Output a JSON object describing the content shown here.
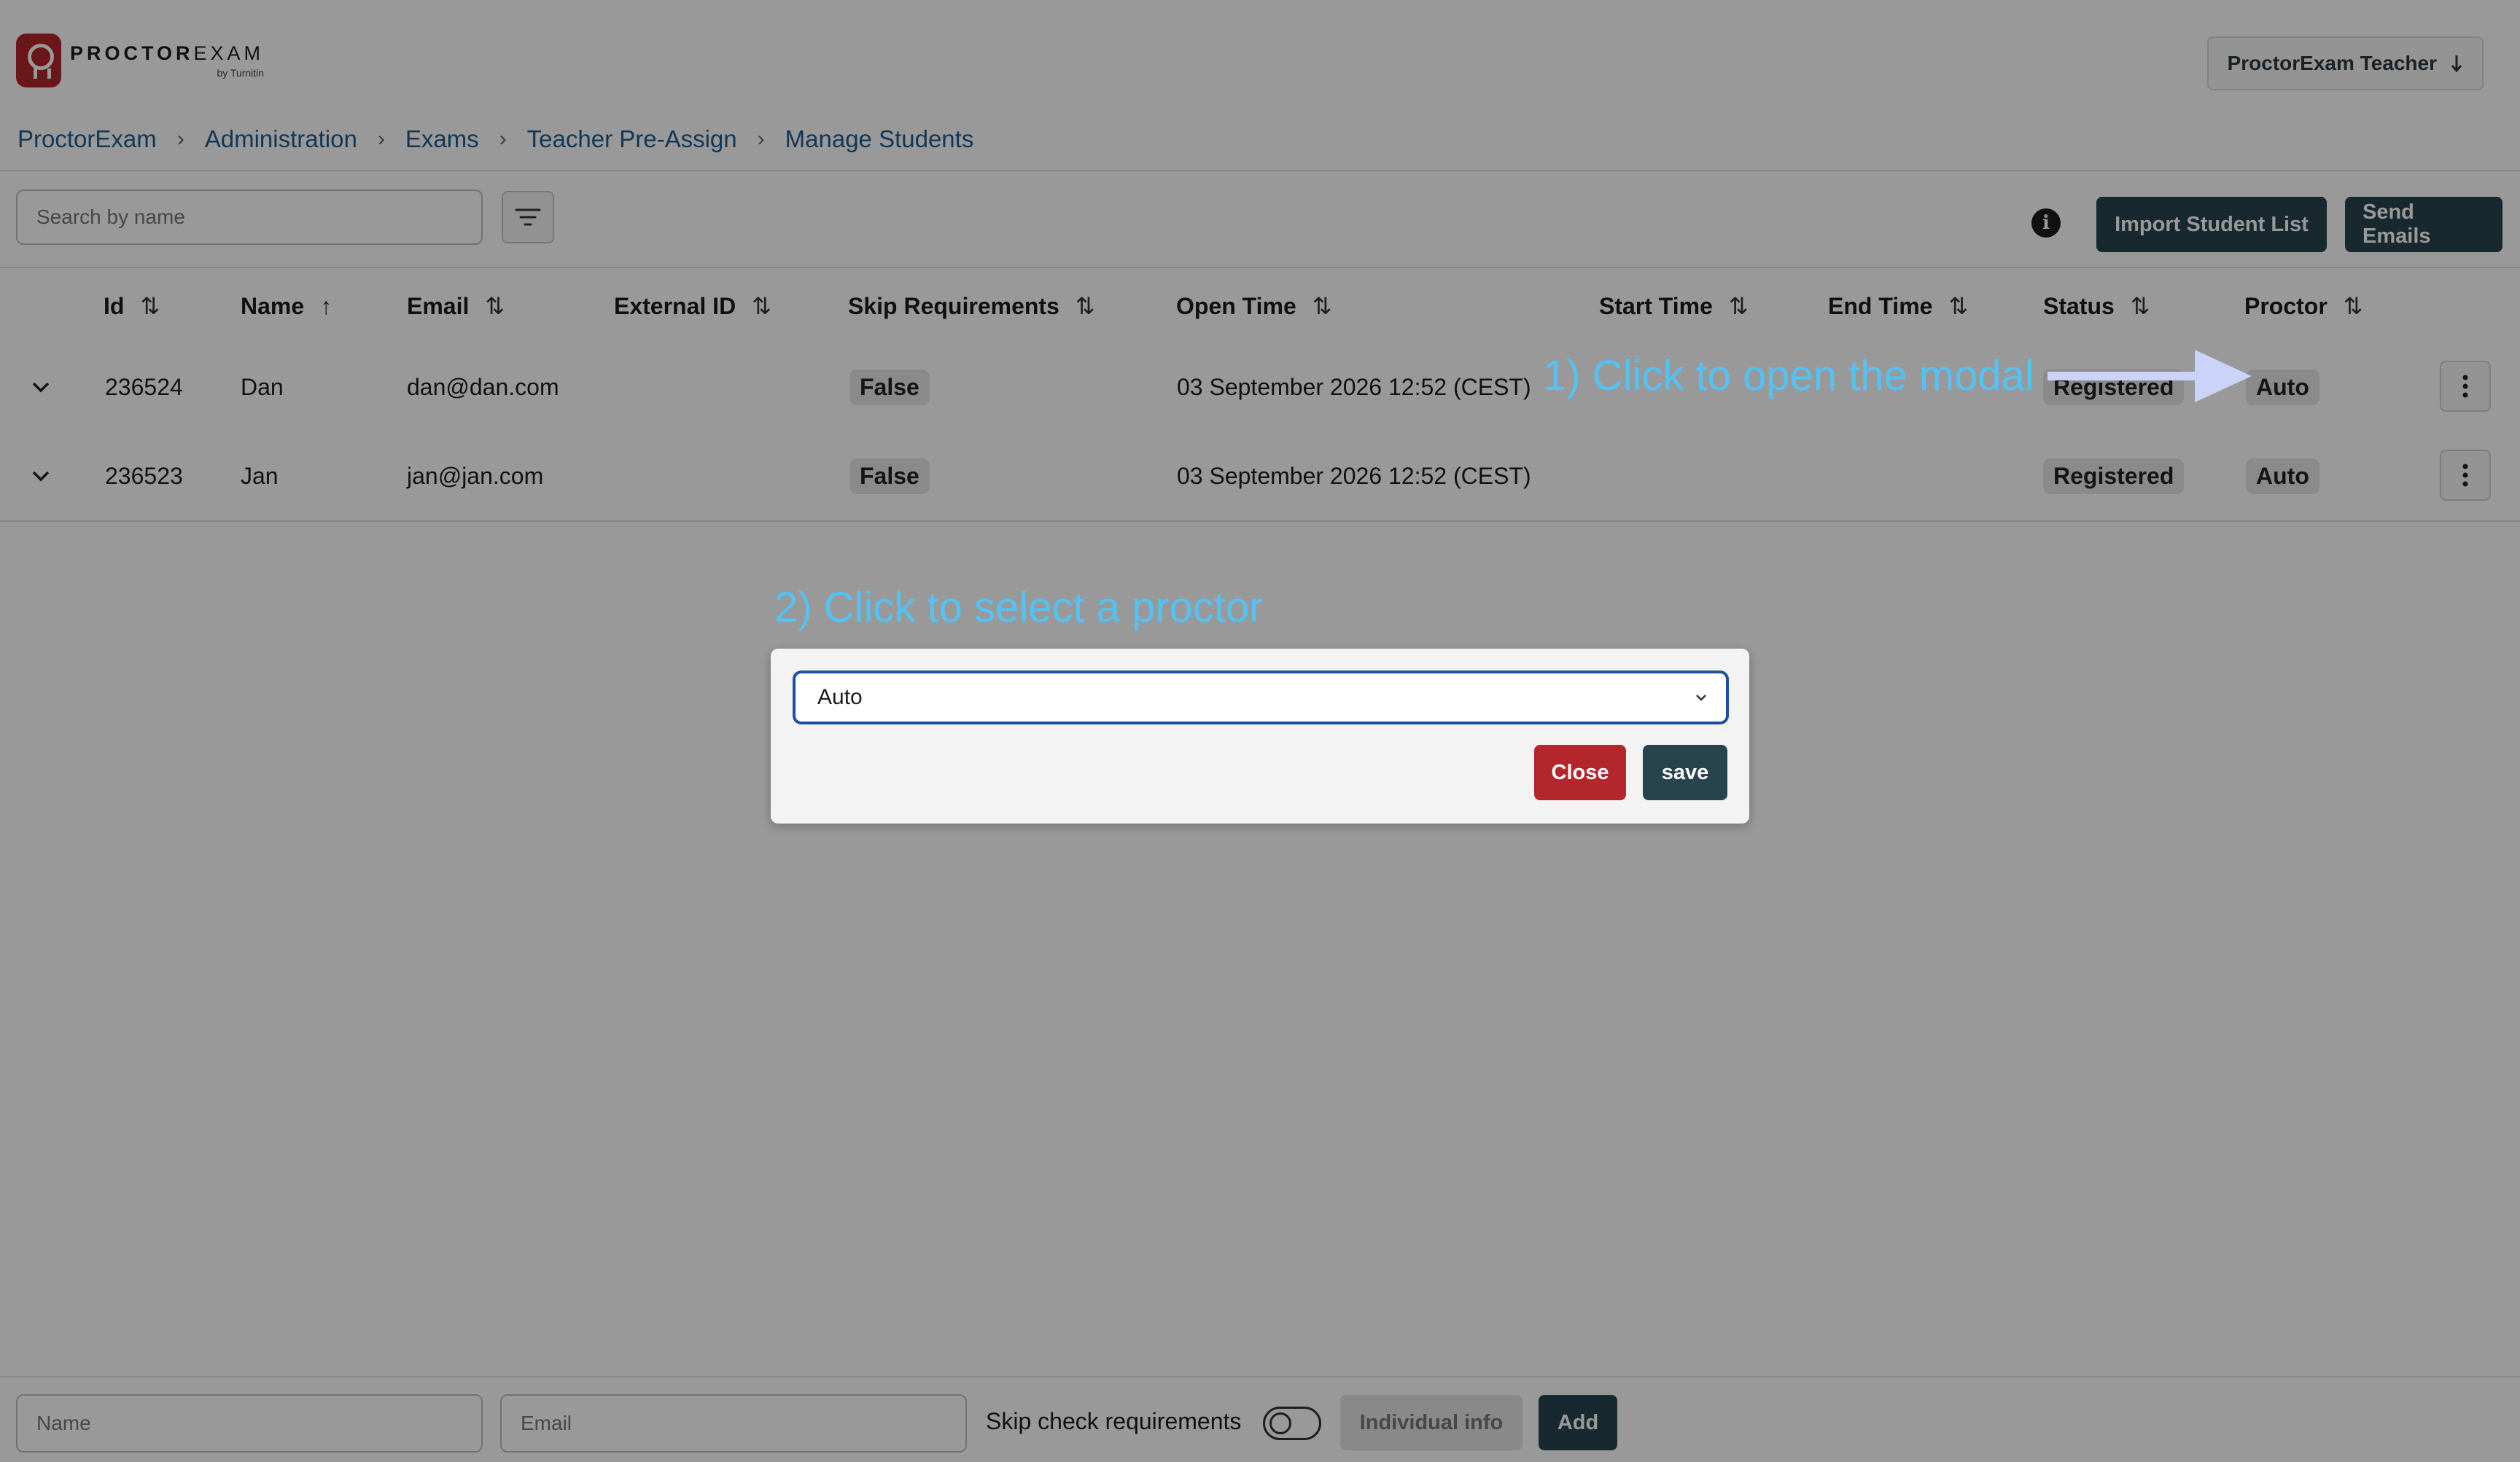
{
  "header": {
    "logo_main_bold": "PROCTOR",
    "logo_main_light": "EXAM",
    "logo_sub": "by Turnitin",
    "user_menu_label": "ProctorExam Teacher",
    "user_menu_icon": "arrow-down-icon"
  },
  "breadcrumb": [
    "ProctorExam",
    "Administration",
    "Exams",
    "Teacher Pre-Assign",
    "Manage Students"
  ],
  "toolbar": {
    "search_placeholder": "Search by name",
    "import_label": "Import Student List",
    "send_label": "Send Emails",
    "info_glyph": "i"
  },
  "table": {
    "columns": [
      "Id",
      "Name",
      "Email",
      "External ID",
      "Skip Requirements",
      "Open Time",
      "Start Time",
      "End Time",
      "Status",
      "Proctor"
    ],
    "sort_glyphs": {
      "both": "⇅",
      "asc": "↑"
    },
    "rows": [
      {
        "id": "236524",
        "name": "Dan",
        "email": "dan@dan.com",
        "external_id": "",
        "skip": "False",
        "open_time": "03 September 2026 12:52 (CEST)",
        "start_time": "",
        "end_time": "",
        "status": "Registered",
        "proctor": "Auto"
      },
      {
        "id": "236523",
        "name": "Jan",
        "email": "jan@jan.com",
        "external_id": "",
        "skip": "False",
        "open_time": "03 September 2026 12:52 (CEST)",
        "start_time": "",
        "end_time": "",
        "status": "Registered",
        "proctor": "Auto"
      }
    ]
  },
  "bottom_bar": {
    "name_placeholder": "Name",
    "email_placeholder": "Email",
    "skip_label": "Skip check requirements",
    "skip_toggle_on": false,
    "individual_info_label": "Individual info",
    "add_label": "Add"
  },
  "annotations": {
    "step1": "1) Click to open the modal",
    "step2": "2) Click to select a proctor",
    "color": "#53c2f4"
  },
  "modal": {
    "select_value": "Auto",
    "close_label": "Close",
    "save_label": "save"
  },
  "colors": {
    "accent_dark": "#27434d",
    "danger": "#b3262b",
    "link": "#1f5d92",
    "focus_border": "#1f4fa0"
  }
}
